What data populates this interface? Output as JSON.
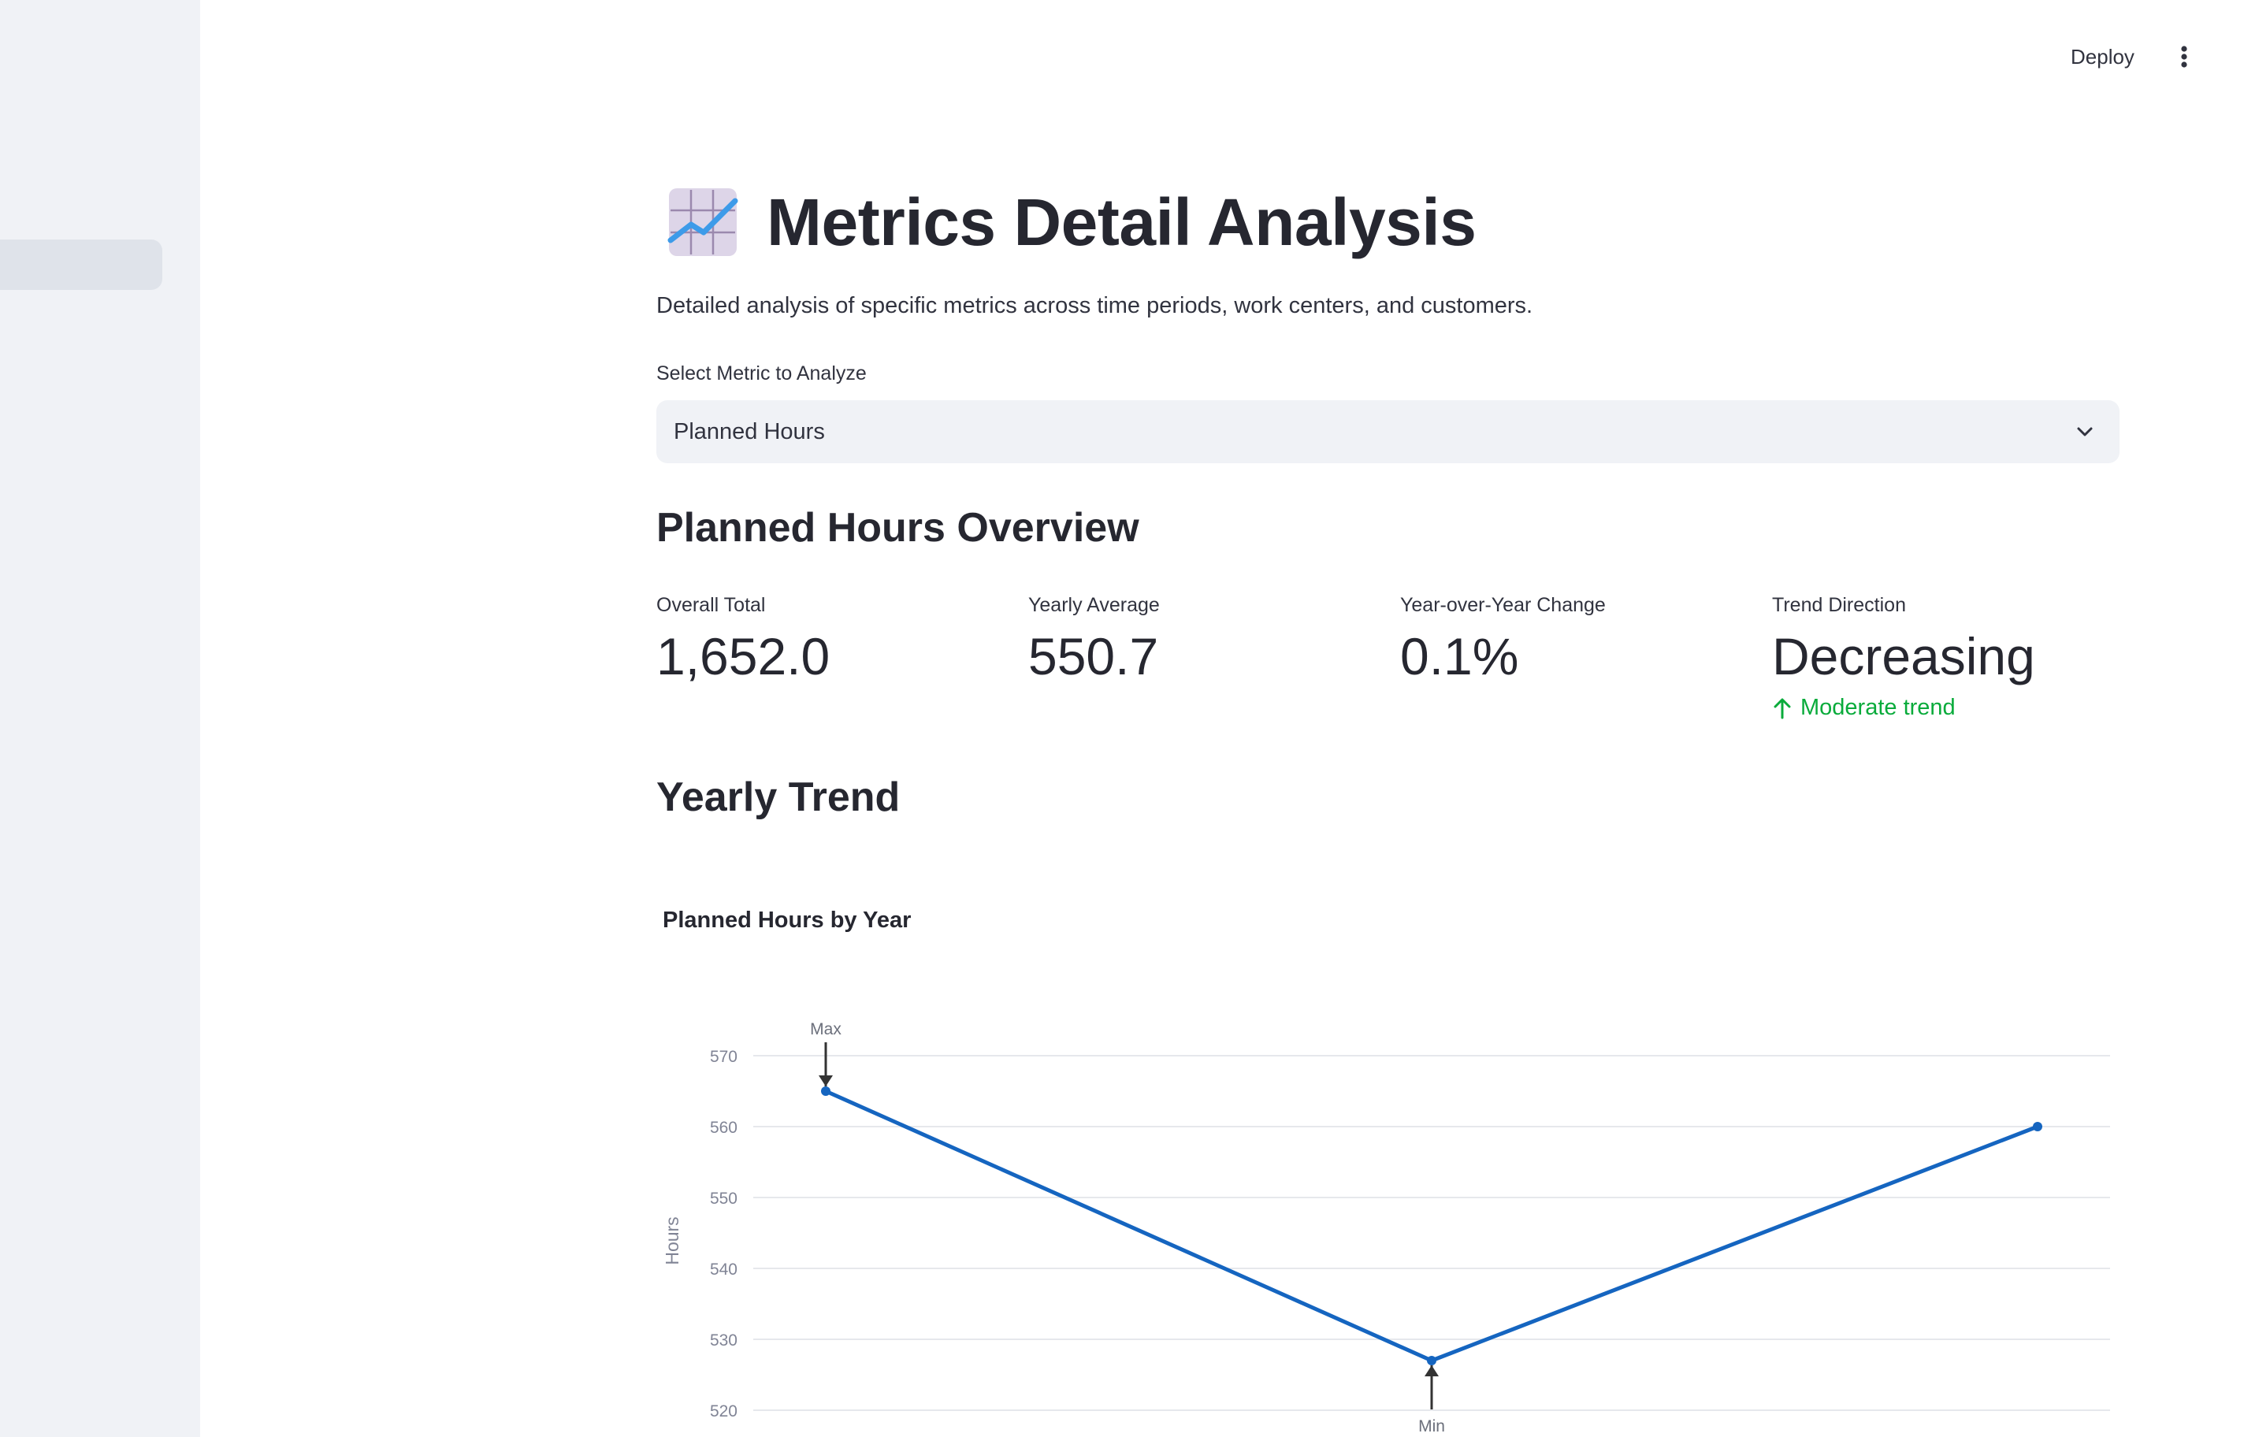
{
  "topbar": {
    "deploy_label": "Deploy",
    "menu_icon": "vertical-ellipsis-icon"
  },
  "header": {
    "icon": "chart-increasing-icon",
    "title": "Metrics Detail Analysis",
    "subtitle": "Detailed analysis of specific metrics across time periods, work centers, and customers."
  },
  "metric_select": {
    "label": "Select Metric to Analyze",
    "value": "Planned Hours"
  },
  "overview": {
    "heading": "Planned Hours Overview",
    "metrics": [
      {
        "label": "Overall Total",
        "value": "1,652.0"
      },
      {
        "label": "Yearly Average",
        "value": "550.7"
      },
      {
        "label": "Year-over-Year Change",
        "value": "0.1%"
      },
      {
        "label": "Trend Direction",
        "value": "Decreasing",
        "delta": "Moderate trend",
        "delta_icon": "arrow-up-icon"
      }
    ]
  },
  "trend": {
    "heading": "Yearly Trend"
  },
  "colors": {
    "line": "#1565c0",
    "delta_positive": "#09ab3b",
    "sidebar_bg": "#f0f2f6"
  },
  "chart_data": {
    "type": "line",
    "title": "Planned Hours by Year",
    "ylabel": "Hours",
    "xlabel": "",
    "x": [
      0,
      1,
      2
    ],
    "series": [
      {
        "values": [
          565,
          527,
          560
        ]
      }
    ],
    "ylim": [
      520,
      570
    ],
    "yticks": [
      520,
      530,
      540,
      550,
      560,
      570
    ],
    "grid": true,
    "annotations": [
      {
        "text": "Max",
        "point_index": 0
      },
      {
        "text": "Min",
        "point_index": 1
      }
    ]
  }
}
